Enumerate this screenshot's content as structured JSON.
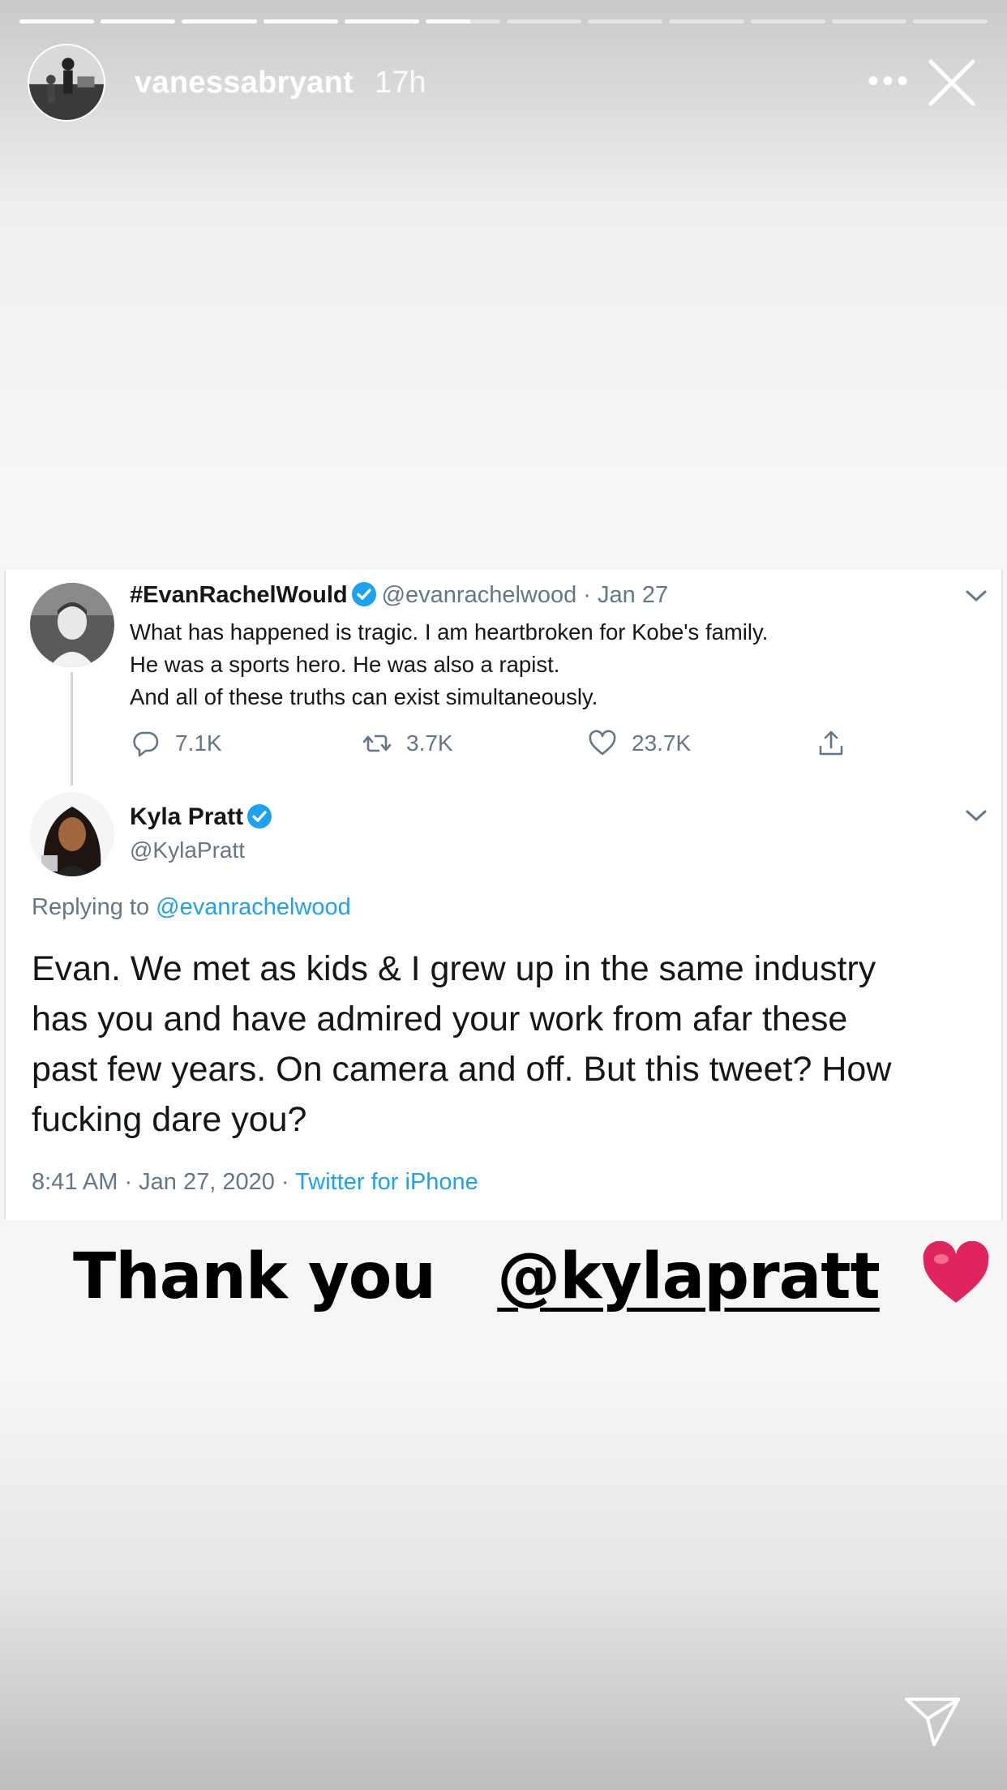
{
  "story": {
    "segments": [
      1,
      1,
      1,
      1,
      1,
      0.6,
      0,
      0,
      0,
      0,
      0,
      0
    ],
    "username": "vanessabryant",
    "time_ago": "17h",
    "more_label": "•••",
    "caption_prefix": "Thank you",
    "caption_mention": "@kylapratt",
    "caption_emoji": "red-heart"
  },
  "tweet": {
    "original": {
      "name": "#EvanRachelWould",
      "handle": "@evanrachelwood",
      "separator": "·",
      "date": "Jan 27",
      "lines": [
        "What has happened is tragic. I am heartbroken for Kobe's family.",
        "He was a sports hero. He was also a rapist.",
        "And all of these truths can exist simultaneously."
      ],
      "replies": "7.1K",
      "retweets": "3.7K",
      "likes": "23.7K"
    },
    "reply": {
      "name": "Kyla Pratt",
      "handle": "@KylaPratt",
      "replying_prefix": "Replying to",
      "replying_to": "@evanrachelwood",
      "lines": [
        "Evan. We met as kids & I grew up in the same industry",
        "has you and have admired your work from afar these",
        "past few years. On camera and off. But this tweet? How",
        "fucking dare you?"
      ],
      "timestamp": "8:41 AM · Jan 27, 2020 ·",
      "source": "Twitter for iPhone"
    }
  },
  "colors": {
    "link": "#1da1f2",
    "muted": "#657786",
    "verified": "#1da1f2",
    "heart": "#e0245e"
  }
}
